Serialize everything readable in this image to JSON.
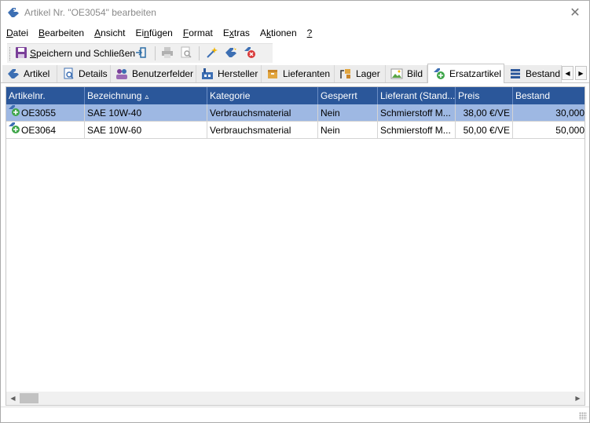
{
  "window": {
    "title": "Artikel Nr. \"OE3054\" bearbeiten",
    "close_glyph": "✕"
  },
  "menu": [
    {
      "pre": "",
      "key": "D",
      "post": "atei"
    },
    {
      "pre": "",
      "key": "B",
      "post": "earbeiten"
    },
    {
      "pre": "",
      "key": "A",
      "post": "nsicht"
    },
    {
      "pre": "Ei",
      "key": "n",
      "post": "fügen"
    },
    {
      "pre": "",
      "key": "F",
      "post": "ormat"
    },
    {
      "pre": "E",
      "key": "x",
      "post": "tras"
    },
    {
      "pre": "A",
      "key": "k",
      "post": "tionen"
    },
    {
      "pre": "",
      "key": "?",
      "post": ""
    }
  ],
  "toolbar": {
    "save_key": "S",
    "save_rest": "peichern und Schließen",
    "icons": [
      "save-icon",
      "exit-icon",
      "print-icon",
      "print-preview-icon",
      "magic-wand-icon",
      "tools-icon",
      "delete-icon"
    ]
  },
  "tabs": [
    {
      "label": "Artikel",
      "icon": "article-icon"
    },
    {
      "label": "Details",
      "icon": "details-icon"
    },
    {
      "label": "Benutzerfelder",
      "icon": "userfields-icon"
    },
    {
      "label": "Hersteller",
      "icon": "manufacturer-icon"
    },
    {
      "label": "Lieferanten",
      "icon": "supplier-icon"
    },
    {
      "label": "Lager",
      "icon": "warehouse-icon"
    },
    {
      "label": "Bild",
      "icon": "image-icon"
    },
    {
      "label": "Ersatzartikel",
      "icon": "replacement-icon",
      "active": true
    },
    {
      "label": "Bestand",
      "icon": "stock-icon"
    }
  ],
  "grid": {
    "columns": [
      "Artikelnr.",
      "Bezeichnung",
      "Kategorie",
      "Gesperrt",
      "Lieferant (Stand...",
      "Preis",
      "Bestand"
    ],
    "sort_indicator": "▵",
    "rows": [
      {
        "artikelnr": "OE3055",
        "bezeichnung": "SAE 10W-40",
        "kategorie": "Verbrauchsmaterial",
        "gesperrt": "Nein",
        "lieferant": "Schmierstoff M...",
        "preis": "38,00 €/VE",
        "bestand": "30,000",
        "selected": true
      },
      {
        "artikelnr": "OE3064",
        "bezeichnung": "SAE 10W-60",
        "kategorie": "Verbrauchsmaterial",
        "gesperrt": "Nein",
        "lieferant": "Schmierstoff M...",
        "preis": "50,00 €/VE",
        "bestand": "50,000",
        "selected": false
      }
    ]
  },
  "colors": {
    "header_bg": "#2b579a",
    "selected_row": "#9eb8e3"
  }
}
